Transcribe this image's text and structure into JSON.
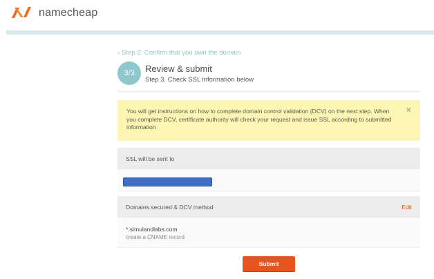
{
  "header": {
    "brand": "namecheap",
    "logo_icon": "namecheap-logo",
    "brand_color": "#f4661b"
  },
  "back_link": {
    "label": "Step 2: Confirm that you own the domain",
    "icon": "chevron-left-icon"
  },
  "step": {
    "badge": "3/3",
    "title": "Review & submit",
    "subtitle": "Step 3. Check SSL information below"
  },
  "notice": {
    "text": "You will get instructions on how to complete domain control validation (DCV) on the next step. When you complete DCV, certificate authority will check your request and issue SSL according to submitted information",
    "close_icon": "close-icon"
  },
  "ssl_panel": {
    "heading": "SSL will be sent to"
  },
  "domains_panel": {
    "heading": "Domains secured & DCV method",
    "edit_label": "Edit",
    "domain": "*.simulandlabs.com",
    "method": "create a CNAME record"
  },
  "submit_label": "Submit",
  "colors": {
    "accent": "#e8541e",
    "teal": "#8ec8cd",
    "notice_bg": "#fdf5b4"
  }
}
